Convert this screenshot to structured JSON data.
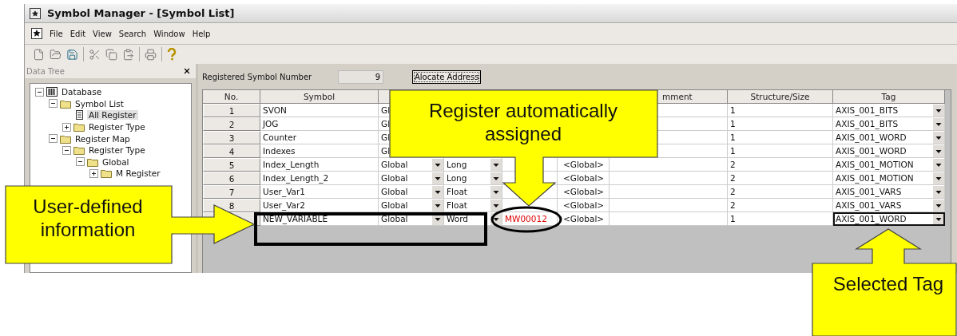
{
  "window": {
    "title": "Symbol Manager - [Symbol List]"
  },
  "menu": [
    {
      "label": "File"
    },
    {
      "label": "Edit"
    },
    {
      "label": "View"
    },
    {
      "label": "Search"
    },
    {
      "label": "Window"
    },
    {
      "label": "Help"
    }
  ],
  "toolbar": [
    {
      "kind": "new"
    },
    {
      "kind": "open"
    },
    {
      "kind": "save"
    },
    {
      "kind": "sep"
    },
    {
      "kind": "cut"
    },
    {
      "kind": "copy"
    },
    {
      "kind": "paste"
    },
    {
      "kind": "sep"
    },
    {
      "kind": "print"
    },
    {
      "kind": "sep"
    },
    {
      "kind": "help"
    }
  ],
  "data_tree": {
    "title": "Data Tree",
    "items": [
      {
        "label": "Database",
        "kind": "database",
        "expanded": true,
        "selected": false,
        "children": [
          {
            "label": "Symbol List",
            "kind": "folder",
            "expanded": true,
            "selected": false,
            "children": [
              {
                "label": "All Register",
                "kind": "list",
                "selected": true
              },
              {
                "label": "Register Type",
                "kind": "folder",
                "expanded": false,
                "selected": false
              }
            ]
          },
          {
            "label": "Register Map",
            "kind": "folder",
            "expanded": true,
            "selected": false,
            "children": [
              {
                "label": "Register Type",
                "kind": "folder",
                "expanded": true,
                "selected": false,
                "children": [
                  {
                    "label": "Global",
                    "kind": "folder",
                    "expanded": true,
                    "selected": false,
                    "children": [
                      {
                        "label": "M Register",
                        "kind": "folder",
                        "expanded": false,
                        "selected": false
                      }
                    ]
                  }
                ]
              }
            ]
          }
        ]
      }
    ]
  },
  "symbol_count": {
    "label": "Registered Symbol Number",
    "value": "9"
  },
  "allocate_button": "Alocate Address",
  "table": {
    "header": {
      "no": "No.",
      "symbol": "Symbol",
      "comment": "mment",
      "size": "Structure/Size",
      "tag": "Tag"
    },
    "rows": [
      {
        "no": "1",
        "symbol": "SVON",
        "scope": "Gl",
        "size": "1",
        "tag": "AXIS_001_BITS",
        "selected": false
      },
      {
        "no": "2",
        "symbol": "JOG",
        "scope": "Gl",
        "size": "1",
        "tag": "AXIS_001_BITS",
        "selected": false
      },
      {
        "no": "3",
        "symbol": "Counter",
        "scope": "Gl",
        "size": "1",
        "tag": "AXIS_001_WORD",
        "selected": false
      },
      {
        "no": "4",
        "symbol": "Indexes",
        "scope": "Gl",
        "size": "1",
        "tag": "AXIS_001_WORD",
        "selected": false
      },
      {
        "no": "5",
        "symbol": "Index_Length",
        "scope": "Global",
        "type": "Long",
        "scope_2": "<Global>",
        "size": "2",
        "tag": "AXIS_001_MOTION",
        "selected": false
      },
      {
        "no": "6",
        "symbol": "Index_Length_2",
        "scope": "Global",
        "type": "Long",
        "scope_2": "<Global>",
        "size": "2",
        "tag": "AXIS_001_MOTION",
        "selected": false
      },
      {
        "no": "7",
        "symbol": "User_Var1",
        "scope": "Global",
        "type": "Float",
        "scope_2": "<Global>",
        "size": "2",
        "tag": "AXIS_001_VARS",
        "selected": false
      },
      {
        "no": "8",
        "symbol": "User_Var2",
        "scope": "Global",
        "type": "Float",
        "scope_2": "<Global>",
        "size": "2",
        "tag": "AXIS_001_VARS",
        "selected": false
      },
      {
        "symbol": "NEW_VARIABLE",
        "scope": "Global",
        "type": "Word",
        "address": "MW00012",
        "scope_2": "<Global>",
        "size": "1",
        "tag": "AXIS_001_WORD",
        "new": true,
        "selected": true
      }
    ]
  },
  "annotations": [
    {
      "kind": "down",
      "text": "Register automatically assigned"
    },
    {
      "kind": "right",
      "text": "User-defined information"
    },
    {
      "kind": "up",
      "text": "Selected Tag"
    }
  ]
}
